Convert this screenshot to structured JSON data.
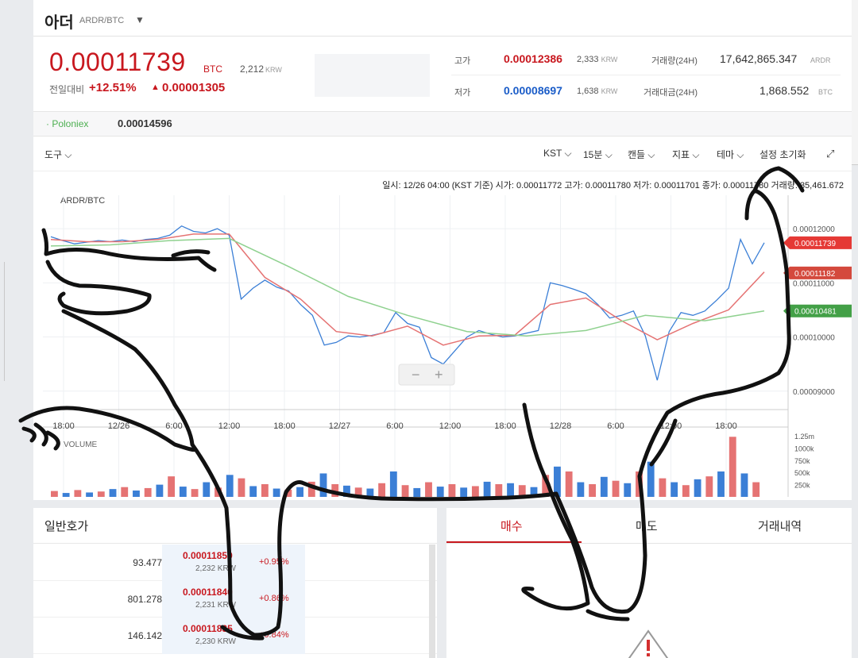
{
  "header": {
    "coin_name": "아더",
    "pair": "ARDR/BTC",
    "caret": "▼"
  },
  "price": {
    "main": "0.00011739",
    "unit": "BTC",
    "krw": "2,212",
    "krw_unit": "KRW",
    "change_label": "전일대비",
    "change_pct": "+12.51%",
    "change_arrow": "▲",
    "change_amt": "0.00001305"
  },
  "stats": {
    "high_label": "고가",
    "high_val": "0.00012386",
    "high_krw": "2,333",
    "high_krw_unit": "KRW",
    "low_label": "저가",
    "low_val": "0.00008697",
    "low_krw": "1,638",
    "low_krw_unit": "KRW",
    "vol_label": "거래량(24H)",
    "vol_val": "17,642,865.347",
    "vol_unit": "ARDR",
    "amt_label": "거래대금(24H)",
    "amt_val": "1,868.552",
    "amt_unit": "BTC"
  },
  "poloniex": {
    "label": "· Poloniex",
    "value": "0.00014596"
  },
  "toolbar": {
    "tools": "도구 ⌵",
    "tz": "KST ⌵",
    "interval": "15분 ⌵",
    "candle": "캔들 ⌵",
    "indicator": "지표 ⌵",
    "theme": "테마 ⌵",
    "reset": "설정 초기화",
    "expand": "⤢"
  },
  "chart_info": {
    "line": "일시: 12/26 04:00 (KST 기준) 시가: 0.00011772 고가: 0.00011780 저가: 0.00011701 종가: 0.00011780 거래량: 35,461.672",
    "symbol": "ARDR/BTC",
    "volume_label": "VOLUME",
    "zoom_minus": "−",
    "zoom_plus": "+"
  },
  "chart_data": {
    "type": "line",
    "title": "ARDR/BTC",
    "x_ticks": [
      "18:00",
      "12/26",
      "6:00",
      "12:00",
      "18:00",
      "12/27",
      "6:00",
      "12:00",
      "18:00",
      "12/28",
      "6:00",
      "12:00",
      "18:00"
    ],
    "y_ticks": [
      "0.00012000",
      "0.00011000",
      "0.00010000",
      "0.00009000"
    ],
    "y_tick_values": [
      0.00012,
      0.00011,
      0.0001,
      9e-05
    ],
    "ylim": [
      8.66e-05,
      0.0001247
    ],
    "xlim": [
      0,
      60
    ],
    "price_labels": [
      {
        "value": "0.00011739",
        "color": "#e53935"
      },
      {
        "value": "0.00011182",
        "color": "#d4493d"
      },
      {
        "value": "0.00010481",
        "color": "#43a047"
      }
    ],
    "volume_ticks": [
      "1.25m",
      "1000k",
      "750k",
      "500k",
      "250k"
    ],
    "volume_tick_values": [
      1250,
      1000,
      750,
      500,
      250
    ],
    "volume_max": 1300,
    "series": [
      {
        "color": "#3b7fd6",
        "x": [
          0,
          1,
          2,
          3,
          4,
          5,
          6,
          7,
          8,
          9,
          10,
          11,
          12,
          13,
          14,
          15,
          16,
          17,
          18,
          19,
          20,
          21,
          22,
          23,
          24,
          25,
          26,
          27,
          28,
          29,
          30,
          31,
          32,
          33,
          34,
          35,
          36,
          37,
          38,
          39,
          40,
          41,
          42,
          43,
          44,
          45,
          46,
          47,
          48,
          49,
          50,
          51,
          52,
          53,
          54,
          55,
          56,
          57,
          58,
          59,
          60
        ],
        "values": [
          0.0001185,
          0.0001178,
          0.0001172,
          0.0001175,
          0.0001178,
          0.0001176,
          0.0001179,
          0.0001176,
          0.000118,
          0.0001182,
          0.0001188,
          0.0001205,
          0.0001195,
          0.0001192,
          0.00012,
          0.0001188,
          0.000107,
          0.000109,
          0.0001105,
          0.0001092,
          0.0001085,
          0.000106,
          0.000104,
          9.85e-05,
          9.9e-05,
          0.0001002,
          0.0001,
          0.0001003,
          0.0001008,
          0.0001045,
          0.0001025,
          0.0001018,
          9.62e-05,
          9.5e-05,
          9.75e-05,
          0.0001,
          0.0001012,
          0.0001005,
          0.0001,
          0.0001002,
          0.0001007,
          0.0001012,
          0.00011,
          0.0001095,
          0.0001088,
          0.000108,
          0.000106,
          0.0001035,
          0.000104,
          0.0001048,
          0.0001002,
          9.2e-05,
          0.000101,
          0.0001045,
          0.000104,
          0.0001048,
          0.0001068,
          0.000109,
          0.000118,
          0.0001135,
          0.0001174
        ]
      },
      {
        "color": "#e57373",
        "x": [
          0,
          3,
          6,
          9,
          12,
          15,
          18,
          21,
          24,
          27,
          30,
          33,
          36,
          39,
          42,
          45,
          48,
          51,
          54,
          57,
          60
        ],
        "values": [
          0.000118,
          0.0001176,
          0.0001176,
          0.000118,
          0.000119,
          0.000119,
          0.000111,
          0.000107,
          0.000101,
          0.0001002,
          0.000102,
          9.85e-05,
          0.0001002,
          0.0001003,
          0.000106,
          0.0001072,
          0.000103,
          9.95e-05,
          0.0001025,
          0.000105,
          0.000112
        ]
      },
      {
        "color": "#8fd18f",
        "x": [
          0,
          5,
          10,
          15,
          20,
          25,
          30,
          35,
          40,
          45,
          50,
          55,
          60
        ],
        "values": [
          0.0001168,
          0.000117,
          0.0001178,
          0.0001182,
          0.000113,
          0.0001075,
          0.000104,
          0.000101,
          0.0001002,
          0.0001012,
          0.000104,
          0.000103,
          0.0001048
        ]
      }
    ],
    "volume": [
      120,
      80,
      140,
      90,
      110,
      160,
      200,
      130,
      180,
      250,
      420,
      210,
      160,
      300,
      190,
      450,
      380,
      220,
      260,
      170,
      150,
      200,
      310,
      480,
      260,
      230,
      190,
      170,
      280,
      520,
      240,
      180,
      300,
      210,
      260,
      190,
      220,
      310,
      260,
      280,
      240,
      200,
      450,
      620,
      520,
      300,
      260,
      410,
      330,
      280,
      520,
      720,
      380,
      300,
      240,
      360,
      420,
      520,
      1230,
      480,
      300
    ],
    "volume_colors": [
      "#e57373",
      "#3b7fd6"
    ]
  },
  "orderbook": {
    "title": "일반호가",
    "rows": [
      {
        "vol": "93.477",
        "price": "0.00011850",
        "krw": "2,232 KRW",
        "pct": "+0.95%"
      },
      {
        "vol": "801.278",
        "price": "0.00011840",
        "krw": "2,231 KRW",
        "pct": "+0.86%"
      },
      {
        "vol": "146.142",
        "price": "0.00011835",
        "krw": "2,230 KRW",
        "pct": "+0.84%"
      }
    ]
  },
  "trade_tabs": {
    "buy": "매수",
    "sell": "매도",
    "history": "거래내역"
  },
  "warning_icon": "warning-triangle-icon",
  "drawing_color": "#111111"
}
